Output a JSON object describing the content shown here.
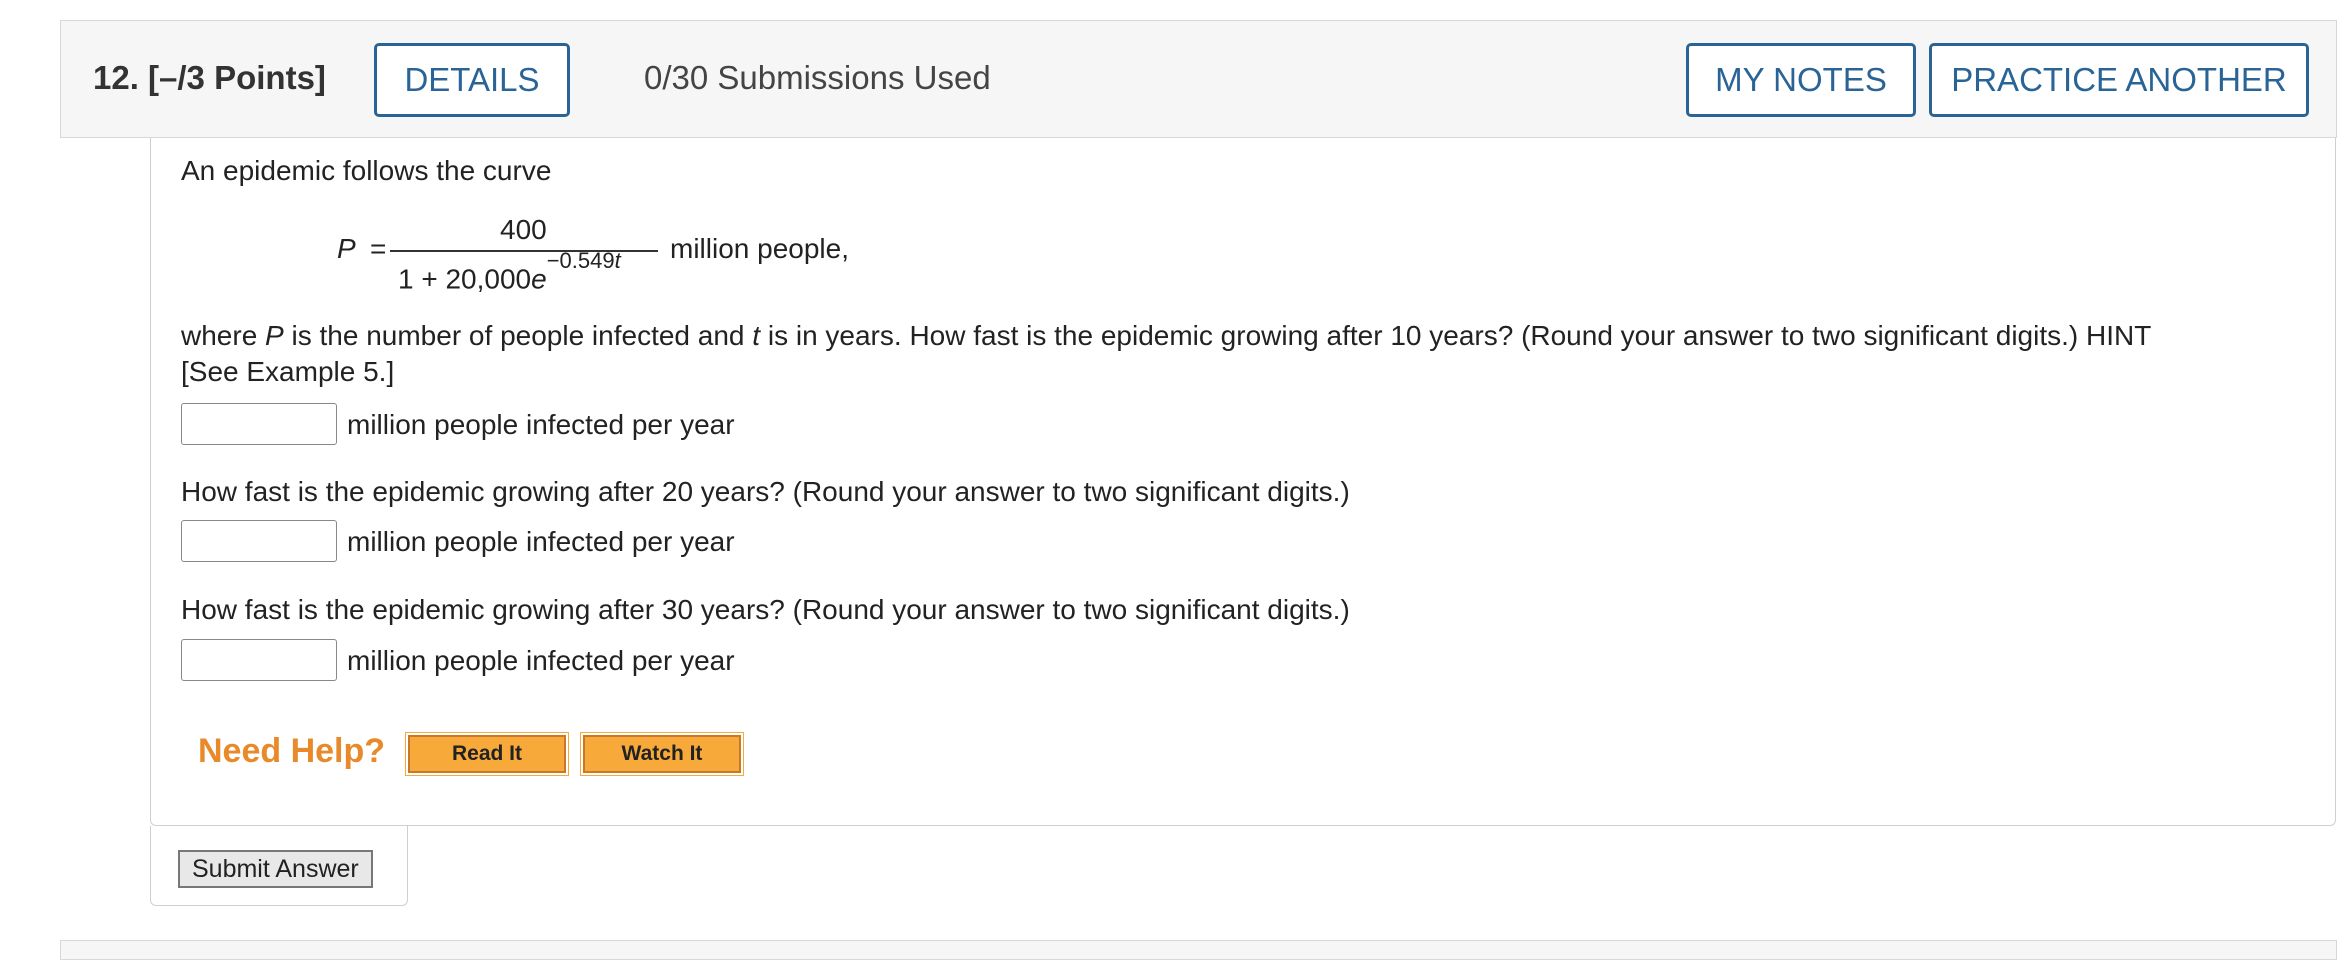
{
  "header": {
    "question_number": "12.",
    "points": "[–/3 Points]",
    "details_label": "DETAILS",
    "submissions": "0/30 Submissions Used",
    "my_notes_label": "MY NOTES",
    "practice_label": "PRACTICE ANOTHER"
  },
  "question": {
    "intro": "An epidemic follows the curve",
    "formula": {
      "lhs": "P",
      "eq": "=",
      "numerator": "400",
      "denominator_base": "1 + 20,000",
      "denominator_e": "e",
      "denominator_exp": "−0.549",
      "denominator_exp_var": "t",
      "suffix": "million people,"
    },
    "prompt1_pre": "where ",
    "prompt1_P": "P",
    "prompt1_mid": " is the number of people infected and ",
    "prompt1_t": "t",
    "prompt1_post": " is in years. How fast is the epidemic growing after 10 years? (Round your answer to two significant digits.) HINT",
    "prompt1_line2": "[See Example 5.]",
    "answers": [
      {
        "value": "",
        "unit": "million people infected per year"
      },
      {
        "value": "",
        "unit": "million people infected per year"
      },
      {
        "value": "",
        "unit": "million people infected per year"
      }
    ],
    "prompt2": "How fast is the epidemic growing after 20 years? (Round your answer to two significant digits.)",
    "prompt3": "How fast is the epidemic growing after 30 years? (Round your answer to two significant digits.)"
  },
  "help": {
    "title": "Need Help?",
    "read_label": "Read It",
    "watch_label": "Watch It"
  },
  "submit_label": "Submit Answer"
}
